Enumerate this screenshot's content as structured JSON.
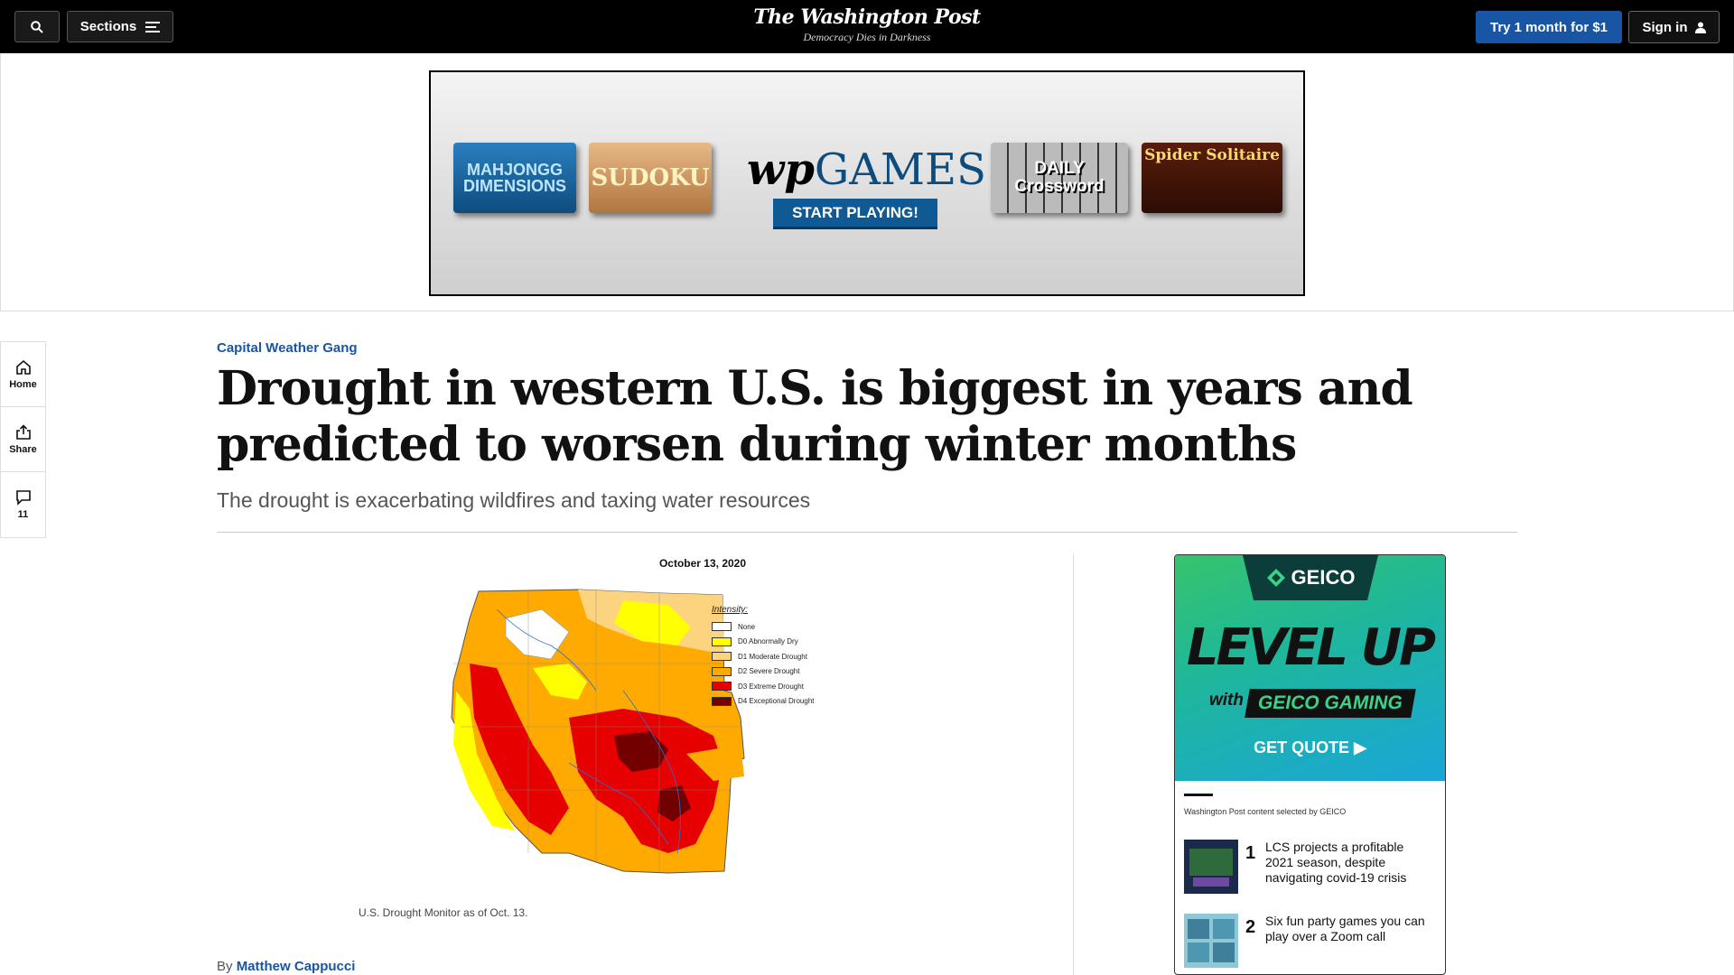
{
  "topbar": {
    "sections_label": "Sections",
    "logo_title": "The Washington Post",
    "logo_tagline": "Democracy Dies in Darkness",
    "try_label": "Try 1 month for $1",
    "signin_label": "Sign in"
  },
  "ad_banner": {
    "mahjong": "MAHJONGG DIMENSIONS",
    "sudoku": "SUDOKU",
    "wpgames_wp": "wp",
    "wpgames_games": "GAMES",
    "start_label": "START PLAYING!",
    "crossword_daily": "DAILY",
    "crossword_word": "Crossword",
    "solitaire": "Spider Solitaire"
  },
  "rail": {
    "home_label": "Home",
    "share_label": "Share",
    "comments_count": "11"
  },
  "article": {
    "kicker": "Capital Weather Gang",
    "headline": "Drought in western U.S. is biggest in years and predicted to worsen during winter months",
    "dek": "The drought is exacerbating wildfires and taxing water resources",
    "byline_prefix": "By",
    "byline_author": "Matthew Cappucci"
  },
  "figure": {
    "date": "October 13, 2020",
    "legend_title": "Intensity:",
    "legend": [
      {
        "label": "None",
        "color": "#ffffff"
      },
      {
        "label": "D0 Abnormally Dry",
        "color": "#ffff00"
      },
      {
        "label": "D1 Moderate Drought",
        "color": "#fcd37f"
      },
      {
        "label": "D2 Severe Drought",
        "color": "#ffaa00"
      },
      {
        "label": "D3 Extreme Drought",
        "color": "#e60000"
      },
      {
        "label": "D4 Exceptional Drought",
        "color": "#730000"
      }
    ],
    "caption": "U.S. Drought Monitor as of Oct. 13."
  },
  "geico_ad": {
    "logo": "GEICO",
    "logo_sub": "GAMING",
    "level_up": "LEVEL UP",
    "with": "with",
    "gaming": "GEICO GAMING",
    "quote": "GET QUOTE ▶",
    "selected": "Washington Post content selected by GEICO",
    "stories": [
      {
        "num": "1",
        "title": "LCS projects a profitable 2021 season, despite navigating covid-19 crisis"
      },
      {
        "num": "2",
        "title": "Six fun party games you can play over a Zoom call"
      }
    ]
  }
}
